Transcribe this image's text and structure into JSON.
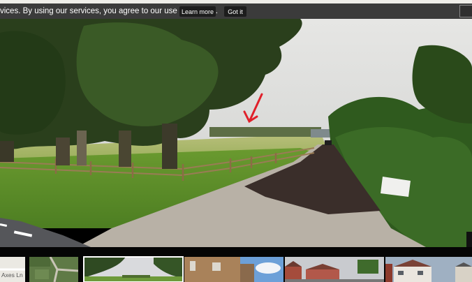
{
  "cookie_bar": {
    "message": "vices. By using our services, you agree to our use of cookies.",
    "learn_more_label": "Learn more",
    "got_it_label": "Got it"
  },
  "filmstrip": {
    "map_thumb_label": "Axes Ln",
    "thumbnails": [
      {
        "kind": "map"
      },
      {
        "kind": "aerial"
      },
      {
        "kind": "street-selected"
      },
      {
        "kind": "building-brick"
      },
      {
        "kind": "houses-red"
      },
      {
        "kind": "house-white"
      }
    ]
  },
  "colors": {
    "cookie_bg": "#3b3b3b",
    "button_bg": "#1d1d1d",
    "annotation_arrow": "#e0202a"
  }
}
